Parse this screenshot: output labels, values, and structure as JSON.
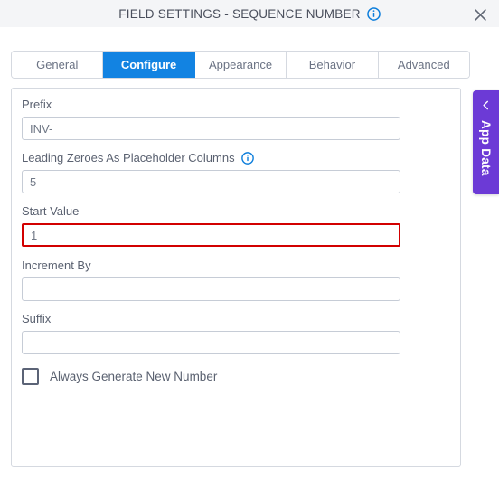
{
  "header": {
    "title": "FIELD SETTINGS - SEQUENCE NUMBER",
    "info_icon": "info-circle-icon",
    "close_icon": "close-icon"
  },
  "tabs": [
    {
      "label": "General",
      "active": false
    },
    {
      "label": "Configure",
      "active": true
    },
    {
      "label": "Appearance",
      "active": false
    },
    {
      "label": "Behavior",
      "active": false
    },
    {
      "label": "Advanced",
      "active": false
    }
  ],
  "form": {
    "fields": [
      {
        "label": "Prefix",
        "value": "INV-",
        "placeholder": "",
        "error": false,
        "has_info": false
      },
      {
        "label": "Leading Zeroes As Placeholder Columns",
        "value": "5",
        "placeholder": "",
        "error": false,
        "has_info": true
      },
      {
        "label": "Start Value",
        "value": "1",
        "placeholder": "",
        "error": true,
        "has_info": false
      },
      {
        "label": "Increment By",
        "value": "",
        "placeholder": "",
        "error": false,
        "has_info": false
      },
      {
        "label": "Suffix",
        "value": "",
        "placeholder": "",
        "error": false,
        "has_info": false
      }
    ],
    "checkbox": {
      "label": "Always Generate New Number",
      "checked": false
    }
  },
  "side_panel": {
    "label": "App Data",
    "chevron_icon": "chevron-left-icon"
  },
  "colors": {
    "accent_blue": "#1283e2",
    "error_red": "#d20000",
    "purple": "#6c3ad6",
    "header_bg": "#f4f5f7"
  }
}
